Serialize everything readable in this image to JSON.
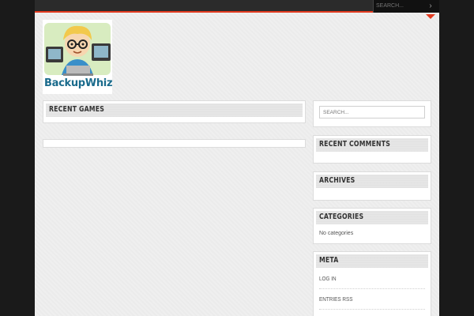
{
  "header": {
    "search_placeholder": "SEARCH...",
    "search_go_glyph": "›"
  },
  "logo": {
    "text": "BackupWhiz"
  },
  "main": {
    "recent_games_title": "RECENT GAMES"
  },
  "sidebar": {
    "search_placeholder": "SEARCH...",
    "recent_comments_title": "RECENT COMMENTS",
    "archives_title": "ARCHIVES",
    "categories_title": "CATEGORIES",
    "categories_empty": "No categories",
    "meta_title": "META",
    "meta_links": [
      "LOG IN",
      "ENTRIES RSS"
    ]
  },
  "colors": {
    "accent": "#e23a1f",
    "topbar": "#2b2b2b",
    "outer_bg": "#1a1a1a",
    "page_bg": "#efefef"
  },
  "icons": {
    "search_go": "chevron-right-icon"
  }
}
